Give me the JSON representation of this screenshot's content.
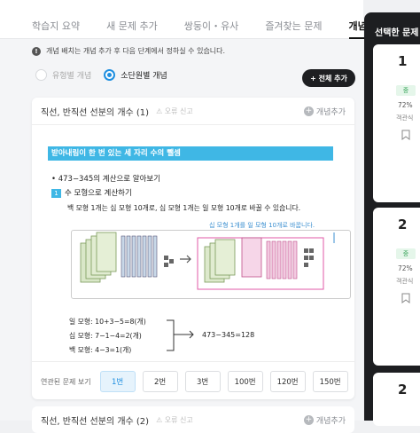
{
  "tabs": [
    {
      "label": "학습지 요약"
    },
    {
      "label": "새 문제 추가"
    },
    {
      "label": "쌍둥이・유사"
    },
    {
      "label": "즐겨찾는 문제"
    },
    {
      "label": "개념 추가"
    }
  ],
  "notice": {
    "icon": "info-icon",
    "text": "개념 배치는 개념 추가 후 다음 단계에서 정하실 수 있습니다."
  },
  "radio_options": [
    {
      "label": "유형별 개념",
      "selected": false
    },
    {
      "label": "소단원별 개념",
      "selected": true
    }
  ],
  "add_all_button": "+ 전체 추가",
  "concept_card": {
    "title": "직선, 반직선 선분의 개수 (1)",
    "report": "⚠ 오류 신고",
    "add_label": "개념추가",
    "content": {
      "banner": "받아내림이 한 번 있는 세 자리 수의 뺄셈",
      "line1": "• 473−345의 계산으로 알아보기",
      "step_num": "1",
      "step_text": "수 모형으로 계산하기",
      "line3": "백 모형 1개는 십 모형 10개로, 십 모형 1개는 일 모형 10개로 바꿀 수 있습니다.",
      "callout": "십 모형 1개를 일 모형 10개로 바꿉니다.",
      "calc1": "일 모형: 10+3−5=8(개)",
      "calc2": "십 모형: 7−1−4=2(개)",
      "calc3": "백 모형: 4−3=1(개)",
      "result": "473−345=128"
    },
    "related_label": "연관된 문제 보기",
    "problem_buttons": [
      "1번",
      "2번",
      "3번",
      "100번",
      "120번",
      "150번"
    ],
    "active_problem": "1번"
  },
  "concept_card_2": {
    "title": "직선, 반직선 선분의 개수 (2)",
    "report": "⚠ 오류 신고",
    "add_label": "개념추가"
  },
  "sidebar": {
    "title": "선택한 문제",
    "items": [
      {
        "num": "1",
        "difficulty": "중",
        "rate": "72%",
        "type": "객관식"
      },
      {
        "num": "2",
        "difficulty": "중",
        "rate": "72%",
        "type": "객관식"
      },
      {
        "num": "2"
      }
    ]
  },
  "colors": {
    "accent": "#1f8fe0",
    "banner": "#3fb7e5",
    "dark": "#1d1e21",
    "difficulty_bg": "#e5f6ea"
  }
}
